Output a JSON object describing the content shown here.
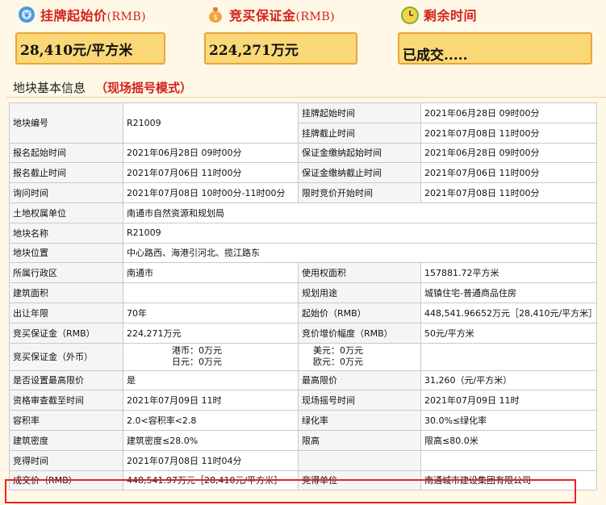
{
  "header": {
    "start_price": {
      "label": "挂牌起始价",
      "unit": "(RMB)",
      "value": "28,410元/平方米"
    },
    "deposit": {
      "label": "竞买保证金",
      "unit": "(RMB)",
      "value": "224,271万元"
    },
    "remaining": {
      "label": "剩余时间",
      "value": "已成交....."
    }
  },
  "section": {
    "title": "地块基本信息",
    "mode": "（现场摇号模式）"
  },
  "rows": {
    "r1": {
      "l1": "地块编号",
      "v1": "R21009",
      "l2a": "挂牌起始时间",
      "v2a": "2021年06月28日 09时00分",
      "l2b": "挂牌截止时间",
      "v2b": "2021年07月08日 11时00分"
    },
    "r2": {
      "l1": "报名起始时间",
      "v1": "2021年06月28日 09时00分",
      "l2": "保证金缴纳起始时间",
      "v2": "2021年06月28日 09时00分"
    },
    "r3": {
      "l1": "报名截止时间",
      "v1": "2021年07月06日 11时00分",
      "l2": "保证金缴纳截止时间",
      "v2": "2021年07月06日 11时00分"
    },
    "r4": {
      "l1": "询问时间",
      "v1": "2021年07月08日 10时00分-11时00分",
      "l2": "限时竞价开始时间",
      "v2": "2021年07月08日 11时00分"
    },
    "r5": {
      "l1": "土地权属单位",
      "v1": "南通市自然资源和规划局"
    },
    "r6": {
      "l1": "地块名称",
      "v1": "R21009"
    },
    "r7": {
      "l1": "地块位置",
      "v1": "中心路西、海港引河北、揽江路东"
    },
    "r8": {
      "l1": "所属行政区",
      "v1": "南通市",
      "l2": "使用权面积",
      "v2": "157881.72平方米"
    },
    "r9": {
      "l1": "建筑面积",
      "v1": "",
      "l2": "规划用途",
      "v2": "城镇住宅-普通商品住房"
    },
    "r10": {
      "l1": "出让年限",
      "v1": "70年",
      "l2": "起始价（RMB）",
      "v2": "448,541.96652万元［28,410元/平方米］"
    },
    "r11": {
      "l1": "竞买保证金（RMB）",
      "v1": "224,271万元",
      "l2": "竞价增价幅度（RMB）",
      "v2": "50元/平方米"
    },
    "r12": {
      "l1": "竞买保证金（外币）",
      "hk": "港币：0万元",
      "jp": "日元：0万元",
      "us": "美元：0万元",
      "eu": "欧元：0万元"
    },
    "r13": {
      "l1": "是否设置最高限价",
      "v1": "是",
      "l2": "最高限价",
      "v2": "31,260（元/平方米）"
    },
    "r14": {
      "l1": "资格审查截至时间",
      "v1": "2021年07月09日 11时",
      "l2": "现场摇号时间",
      "v2": "2021年07月09日 11时"
    },
    "r15": {
      "l1": "容积率",
      "v1": "2.0<容积率<2.8",
      "l2": "绿化率",
      "v2": "30.0%≤绿化率"
    },
    "r16": {
      "l1": "建筑密度",
      "v1": "建筑密度≤28.0%",
      "l2": "限高",
      "v2": "限高≤80.0米"
    },
    "r17": {
      "l1": "竞得时间",
      "v1": "2021年07月08日 11时04分"
    },
    "r18": {
      "l1": "成交价（RMB）",
      "v1": "448,541.97万元［28,410元/平方米］",
      "l2": "竞得单位",
      "v2": "南通城市建设集团有限公司"
    }
  }
}
